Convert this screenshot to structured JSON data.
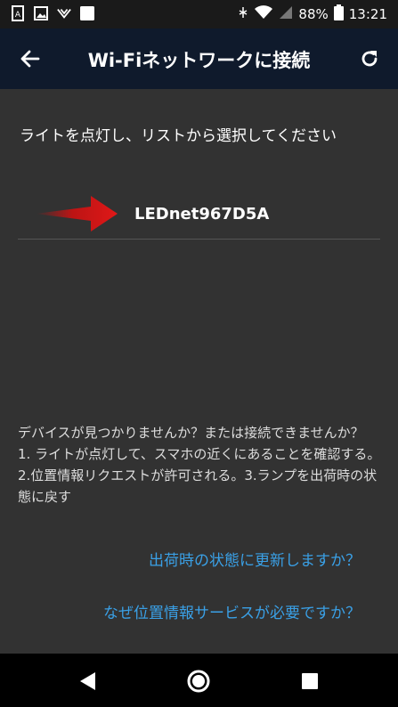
{
  "status_bar": {
    "battery": "88%",
    "time": "13:21"
  },
  "header": {
    "title": "Wi-Fiネットワークに接続"
  },
  "main": {
    "instruction": "ライトを点灯し、リストから選択してください",
    "networks": [
      {
        "name": "LEDnet967D5A"
      }
    ],
    "help_line1": "デバイスが見つかりませんか？または接続できませんか？",
    "help_line2": "1. ライトが点灯して、スマホの近くにあることを確認する。2.位置情報リクエストが許可される。3.ランプを出荷時の状態に戻す",
    "reset_link": "出荷時の状態に更新しますか？",
    "location_link": "なぜ位置情報サービスが必要ですか？"
  },
  "colors": {
    "app_bar": "#0f1a2c",
    "background": "#323232",
    "link": "#3aa0e6",
    "arrow": "#cc1111"
  }
}
